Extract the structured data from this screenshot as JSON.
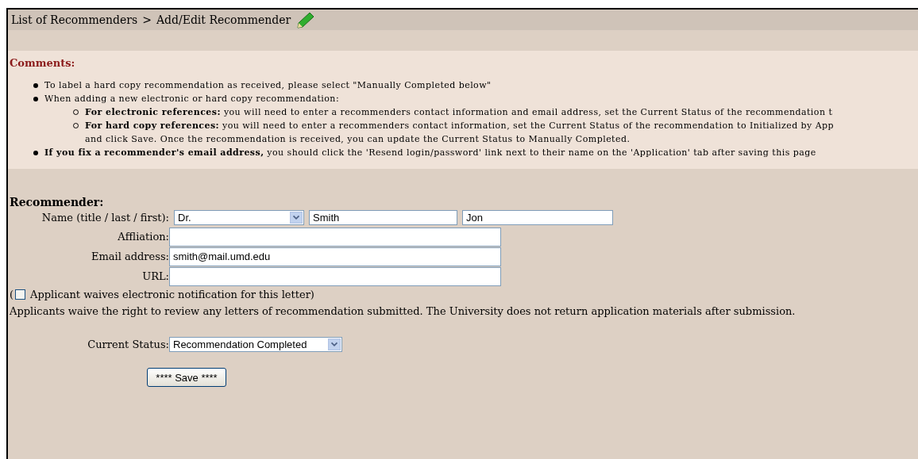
{
  "breadcrumb": {
    "parent": "List of Recommenders",
    "separator": ">",
    "current": "Add/Edit Recommender"
  },
  "comments": {
    "heading": "Comments:",
    "items": [
      {
        "lines": [
          "To label a hard copy recommendation as received, please select \"Manually Completed below\""
        ]
      },
      {
        "lines": [
          "When adding a new electronic or hard copy recommendation:"
        ],
        "children": [
          {
            "lines": [
              "**For electronic references:** you will need to enter a recommenders contact information and email address, set the Current Status of the recommendation t"
            ]
          },
          {
            "lines": [
              "**For hard copy references:** you will need to enter a recommenders contact information, set the Current Status of the recommendation to Initialized by App",
              "and click Save. Once the recommendation is received, you can update the Current Status to Manually Completed."
            ]
          }
        ]
      },
      {
        "lines": [
          "**If you fix a recommender's email address,** you should click the 'Resend login/password' link next to their name on the 'Application' tab after saving this page"
        ]
      }
    ]
  },
  "recommender": {
    "heading": "Recommender:",
    "name": {
      "label": "Name (title / last / first):",
      "title": "Dr.",
      "last": "Smith",
      "first": "Jon"
    },
    "fields": [
      {
        "label": "Affliation:"
      },
      {
        "label": "Email address:",
        "value": "smith@mail.umd.edu"
      },
      {
        "label": "URL:"
      }
    ],
    "waiver": {
      "open": "(",
      "label": "Applicant waives electronic notification for this letter)",
      "checked": false
    },
    "notice": "Applicants waive the right to review any letters of recommendation submitted. The University does not return application materials after submission.",
    "status": {
      "label": "Current Status:",
      "value": "Recommendation Completed"
    },
    "save": "**** Save ****"
  }
}
